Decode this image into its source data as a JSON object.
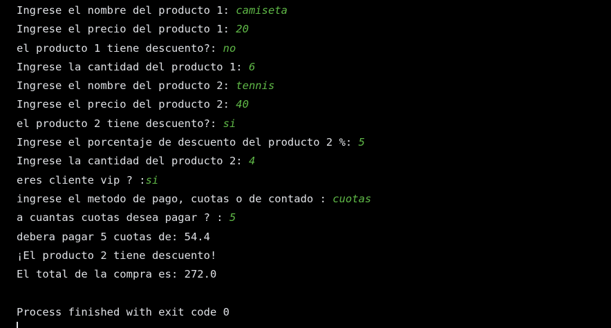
{
  "console": {
    "lines": [
      {
        "prompt": "Ingrese el nombre del producto 1: ",
        "input": "camiseta"
      },
      {
        "prompt": "Ingrese el precio del producto 1: ",
        "input": "20"
      },
      {
        "prompt": "el producto 1 tiene descuento?: ",
        "input": "no"
      },
      {
        "prompt": "Ingrese la cantidad del producto 1: ",
        "input": "6"
      },
      {
        "prompt": "Ingrese el nombre del producto 2: ",
        "input": "tennis"
      },
      {
        "prompt": "Ingrese el precio del producto 2: ",
        "input": "40"
      },
      {
        "prompt": "el producto 2 tiene descuento?: ",
        "input": "si"
      },
      {
        "prompt": "Ingrese el porcentaje de descuento del producto 2 %: ",
        "input": "5"
      },
      {
        "prompt": "Ingrese la cantidad del producto 2: ",
        "input": "4"
      },
      {
        "prompt": "eres cliente vip ? :",
        "input": "si"
      },
      {
        "prompt": "ingrese el metodo de pago, cuotas o de contado : ",
        "input": "cuotas"
      },
      {
        "prompt": "a cuantas cuotas desea pagar ? : ",
        "input": "5"
      },
      {
        "prompt": "debera pagar 5 cuotas de: 54.4",
        "input": ""
      },
      {
        "prompt": "¡El producto 2 tiene descuento!",
        "input": ""
      },
      {
        "prompt": "El total de la compra es: 272.0",
        "input": ""
      }
    ],
    "exit_message": "Process finished with exit code 0"
  },
  "colors": {
    "background": "#000000",
    "text": "#dfe1e5",
    "user_input": "#5fb847"
  }
}
